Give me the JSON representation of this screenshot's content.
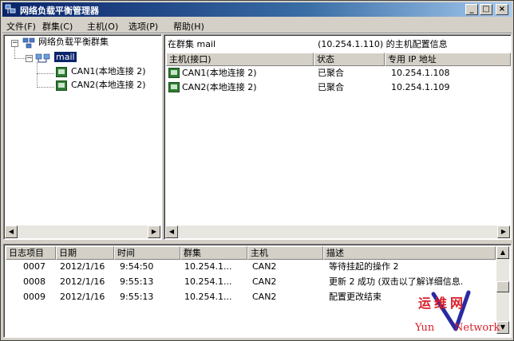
{
  "window": {
    "title": "网络负载平衡管理器"
  },
  "title_buttons": {
    "minimize": "_",
    "maximize": "□",
    "close": "×"
  },
  "menu": [
    "文件(F)",
    "群集(C)",
    "主机(O)",
    "选项(P)",
    "帮助(H)"
  ],
  "tree": {
    "root": "网络负载平衡群集",
    "cluster": "mail",
    "hosts": [
      "CAN1(本地连接 2)",
      "CAN2(本地连接 2)"
    ]
  },
  "hosts_panel": {
    "caption_prefix": "在群集 mail",
    "caption_suffix": "(10.254.1.110) 的主机配置信息",
    "columns": [
      "主机(接口)",
      "状态",
      "专用 IP 地址"
    ],
    "rows": [
      {
        "host": "CAN1(本地连接 2)",
        "status": "已聚合",
        "ip": "10.254.1.108"
      },
      {
        "host": "CAN2(本地连接 2)",
        "status": "已聚合",
        "ip": "10.254.1.109"
      }
    ]
  },
  "log": {
    "columns": [
      "日志项目",
      "日期",
      "时间",
      "群集",
      "主机",
      "描述"
    ],
    "rows": [
      {
        "id": "0007",
        "date": "2012/1/16",
        "time": "9:54:50",
        "cluster": "10.254.1...",
        "host": "CAN2",
        "desc": "等待挂起的操作 2"
      },
      {
        "id": "0008",
        "date": "2012/1/16",
        "time": "9:55:13",
        "cluster": "10.254.1...",
        "host": "CAN2",
        "desc": "更新 2 成功 (双击以了解详细信息."
      },
      {
        "id": "0009",
        "date": "2012/1/16",
        "time": "9:55:13",
        "cluster": "10.254.1...",
        "host": "CAN2",
        "desc": "配置更改结束"
      }
    ]
  },
  "watermark": {
    "top": "运维网",
    "bottom_left": "Yun",
    "bottom_right": "Network",
    "color": "#d8202a",
    "v_color": "#2a2aa0"
  },
  "colors": {
    "selection": "#0a246a",
    "titlebar": "#0a246a",
    "face": "#d4d0c8"
  }
}
